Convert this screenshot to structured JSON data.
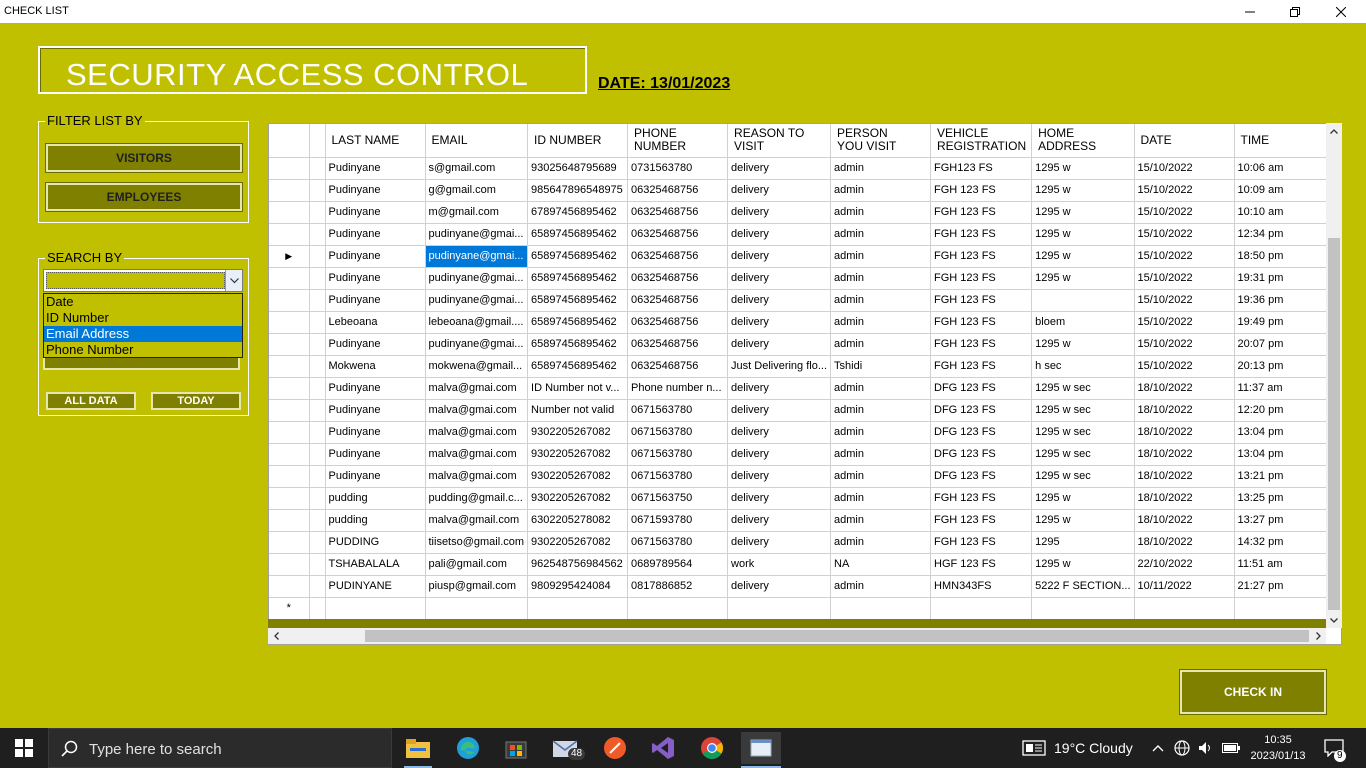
{
  "window": {
    "title": "CHECK LIST"
  },
  "header": {
    "title": "SECURITY ACCESS CONTROL",
    "date_label": "DATE: 13/01/2023"
  },
  "filter": {
    "title": "FILTER LIST BY",
    "visitors_label": "VISITORS",
    "employees_label": "EMPLOYEES"
  },
  "search": {
    "title": "SEARCH BY",
    "combo_value": "",
    "options": [
      "Date",
      "ID Number",
      "Email Address",
      "Phone Number"
    ],
    "selected_option": "Email Address",
    "all_data_label": "ALL DATA",
    "today_label": "TODAY"
  },
  "grid": {
    "columns": [
      "LAST NAME",
      "EMAIL",
      "ID NUMBER",
      "PHONE\nNUMBER",
      "REASON TO\nVISIT",
      "PERSON\nYOU VISIT",
      "VEHICLE\nREGISTRATION",
      "HOME\nADDRESS",
      "DATE",
      "TIME"
    ],
    "rows": [
      [
        "Pudinyane",
        "s@gmail.com",
        "93025648795689",
        "0731563780",
        "delivery",
        "admin",
        "FGH123 FS",
        "1295 w",
        "15/10/2022",
        "10:06 am"
      ],
      [
        "Pudinyane",
        "g@gmail.com",
        "985647896548975",
        "06325468756",
        "delivery",
        "admin",
        "FGH 123 FS",
        "1295 w",
        "15/10/2022",
        "10:09 am"
      ],
      [
        "Pudinyane",
        "m@gmail.com",
        "67897456895462",
        "06325468756",
        "delivery",
        "admin",
        "FGH 123 FS",
        "1295 w",
        "15/10/2022",
        "10:10 am"
      ],
      [
        "Pudinyane",
        "pudinyane@gmai...",
        "65897456895462",
        "06325468756",
        "delivery",
        "admin",
        "FGH 123 FS",
        "1295 w",
        "15/10/2022",
        "12:34 pm"
      ],
      [
        "Pudinyane",
        "pudinyane@gmai...",
        "65897456895462",
        "06325468756",
        "delivery",
        "admin",
        "FGH 123 FS",
        "1295 w",
        "15/10/2022",
        "18:50 pm"
      ],
      [
        "Pudinyane",
        "pudinyane@gmai...",
        "65897456895462",
        "06325468756",
        "delivery",
        "admin",
        "FGH 123 FS",
        "1295 w",
        "15/10/2022",
        "19:31 pm"
      ],
      [
        "Pudinyane",
        "pudinyane@gmai...",
        "65897456895462",
        "06325468756",
        "delivery",
        "admin",
        "FGH 123 FS",
        "",
        "15/10/2022",
        "19:36 pm"
      ],
      [
        "Lebeoana",
        "lebeoana@gmail....",
        "65897456895462",
        "06325468756",
        "delivery",
        "admin",
        "FGH 123 FS",
        "bloem",
        "15/10/2022",
        "19:49 pm"
      ],
      [
        "Pudinyane",
        "pudinyane@gmai...",
        "65897456895462",
        "06325468756",
        "delivery",
        "admin",
        "FGH 123 FS",
        "1295 w",
        "15/10/2022",
        "20:07 pm"
      ],
      [
        "Mokwena",
        "mokwena@gmail...",
        "65897456895462",
        "06325468756",
        "Just Delivering flo...",
        "Tshidi",
        "FGH 123 FS",
        "h sec",
        "15/10/2022",
        "20:13 pm"
      ],
      [
        "Pudinyane",
        "malva@gmai.com",
        "ID Number not v...",
        "Phone number n...",
        "delivery",
        "admin",
        "DFG 123 FS",
        "1295 w sec",
        "18/10/2022",
        "11:37 am"
      ],
      [
        "Pudinyane",
        "malva@gmai.com",
        "Number not valid",
        "0671563780",
        "delivery",
        "admin",
        "DFG 123 FS",
        "1295 w sec",
        "18/10/2022",
        "12:20 pm"
      ],
      [
        "Pudinyane",
        "malva@gmai.com",
        "9302205267082",
        "0671563780",
        "delivery",
        "admin",
        "DFG 123 FS",
        "1295 w sec",
        "18/10/2022",
        "13:04 pm"
      ],
      [
        "Pudinyane",
        "malva@gmai.com",
        "9302205267082",
        "0671563780",
        "delivery",
        "admin",
        "DFG 123 FS",
        "1295 w sec",
        "18/10/2022",
        "13:04 pm"
      ],
      [
        "Pudinyane",
        "malva@gmai.com",
        "9302205267082",
        "0671563780",
        "delivery",
        "admin",
        "DFG 123 FS",
        "1295 w sec",
        "18/10/2022",
        "13:21 pm"
      ],
      [
        "pudding",
        "pudding@gmail.c...",
        "9302205267082",
        "0671563750",
        "delivery",
        "admin",
        "FGH 123 FS",
        "1295 w",
        "18/10/2022",
        "13:25 pm"
      ],
      [
        "pudding",
        "malva@gmail.com",
        "6302205278082",
        "0671593780",
        "delivery",
        "admin",
        "FGH 123 FS",
        "1295 w",
        "18/10/2022",
        "13:27 pm"
      ],
      [
        "PUDDING",
        "tiisetso@gmail.com",
        "9302205267082",
        "0671563780",
        "delivery",
        "admin",
        "FGH 123 FS",
        "1295",
        "18/10/2022",
        "14:32 pm"
      ],
      [
        "TSHABALALA",
        "pali@gmail.com",
        "962548756984562",
        "0689789564",
        "work",
        "NA",
        "HGF 123 FS",
        "1295 w",
        "22/10/2022",
        "11:51 am"
      ],
      [
        "PUDINYANE",
        "piusp@gmail.com",
        "9809295424084",
        "0817886852",
        "delivery",
        "admin",
        "HMN343FS",
        "5222 F SECTION...",
        "10/11/2022",
        "21:27 pm"
      ]
    ],
    "current_row": 4,
    "selected_cell_column": 1,
    "new_row_marker": "*",
    "current_row_marker": "▶"
  },
  "actions": {
    "check_in_label": "CHECK IN"
  },
  "taskbar": {
    "search_placeholder": "Type here to search",
    "mail_badge": "48",
    "weather": "19°C  Cloudy",
    "time": "10:35",
    "date": "2023/01/13",
    "notification_count": "9"
  },
  "colors": {
    "background": "#c0c000",
    "button": "#808000",
    "selection": "#0078d7"
  }
}
